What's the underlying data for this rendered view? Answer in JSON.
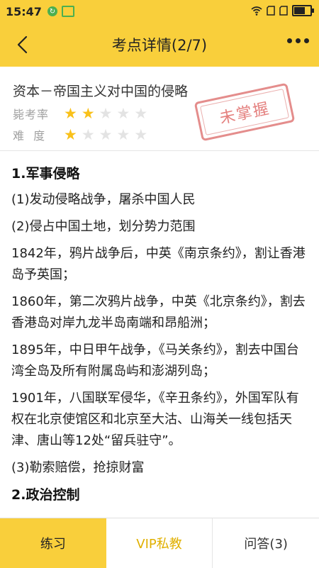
{
  "status": {
    "time": "15:47",
    "battery_level": 0.7
  },
  "nav": {
    "title": "考点详情(2/7)"
  },
  "topic": {
    "title": "资本－帝国主义对中国的侵略",
    "frequency_label": "毙考率",
    "frequency_stars": 2,
    "difficulty_label": "难  度",
    "difficulty_stars": 1,
    "max_stars": 5,
    "stamp": "未掌握"
  },
  "content": {
    "heading1": "1.军事侵略",
    "p1": "(1)发动侵略战争，屠杀中国人民",
    "p2": "(2)侵占中国土地，划分势力范围",
    "p3": "1842年，鸦片战争后，中英《南京条约》，割让香港岛予英国；",
    "p4": "1860年，第二次鸦片战争，中英《北京条约》，割去香港岛对岸九龙半岛南端和昂船洲；",
    "p5": "1895年，中日甲午战争，《马关条约》，割去中国台湾全岛及所有附属岛屿和澎湖列岛；",
    "p6": "1901年，八国联军侵华，《辛丑条约》，外国军队有权在北京使馆区和北京至大沽、山海关一线包括天津、唐山等12处“留兵驻守”。",
    "p7": "(3)勒索赔偿，抢掠财富",
    "heading2": "2.政治控制"
  },
  "tabs": {
    "practice": "练习",
    "vip": "VIP私教",
    "qa": "问答(3)"
  },
  "colors": {
    "accent": "#f9cf3b",
    "star_on": "#f9c11a",
    "star_off": "#e3e3e3",
    "stamp": "#e06a68"
  }
}
